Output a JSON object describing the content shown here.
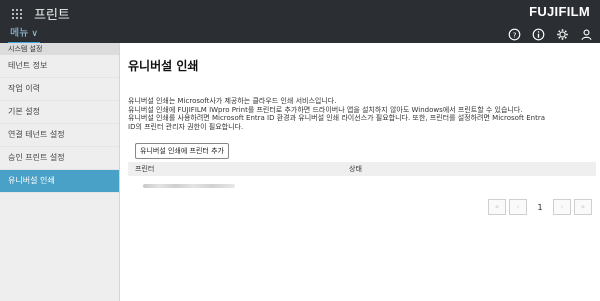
{
  "header": {
    "app_title": "프린트",
    "brand_text": "FUJIFILM",
    "menu_label": "메뉴",
    "icons": [
      "help-icon",
      "info-icon",
      "gear-icon",
      "user-icon"
    ]
  },
  "sidebar": {
    "section_title": "시스템 설정",
    "items": [
      {
        "label": "테넌트 정보",
        "active": false
      },
      {
        "label": "작업 이력",
        "active": false
      },
      {
        "label": "기본 설정",
        "active": false
      },
      {
        "label": "연결 테넌트 설정",
        "active": false
      },
      {
        "label": "승인 프린트 설정",
        "active": false
      },
      {
        "label": "유니버설 인쇄",
        "active": true
      }
    ]
  },
  "main": {
    "title": "유니버설 인쇄",
    "description": [
      "유니버설 인쇄는 Microsoft사가 제공하는 클라우드 인쇄 서비스입니다.",
      "유니버설 인쇄에 FUJIFILM IWpro Print를 프린터로 추가하면 드라이버나 앱을 설치하지 않아도 Windows에서 프린트할 수 있습니다.",
      "유니버설 인쇄를 사용하려면 Microsoft Entra ID 환경과 유니버설 인쇄 라이선스가 필요합니다. 또한, 프린터를 설정하려면 Microsoft Entra",
      "ID의 프린터 관리자 권한이 필요합니다."
    ],
    "add_button": "유니버설 인쇄에 프린터 추가",
    "table": {
      "columns": [
        "프린터",
        "상태"
      ]
    },
    "pagination": {
      "current_page": "1",
      "first": "«",
      "prev": "‹",
      "next": "›",
      "last": "»"
    }
  },
  "colors": {
    "topbar": "#2b2f33",
    "accent": "#3fa1d5",
    "active_item": "#4aa1c8",
    "brand_dot": "#e60012"
  }
}
